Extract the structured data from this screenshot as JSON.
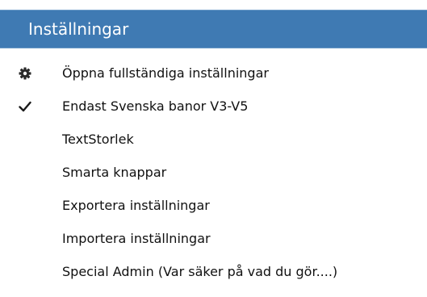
{
  "menu": {
    "title": "Inställningar",
    "items": [
      {
        "label": "Öppna fullständiga inställningar",
        "icon": "gear-icon"
      },
      {
        "label": "Endast Svenska banor V3-V5",
        "icon": "checkmark-icon",
        "checked": true
      },
      {
        "label": "TextStorlek"
      },
      {
        "label": "Smarta knappar"
      },
      {
        "label": "Exportera inställningar"
      },
      {
        "label": "Importera inställningar"
      },
      {
        "label": "Special Admin (Var säker på vad du gör....)"
      }
    ]
  }
}
